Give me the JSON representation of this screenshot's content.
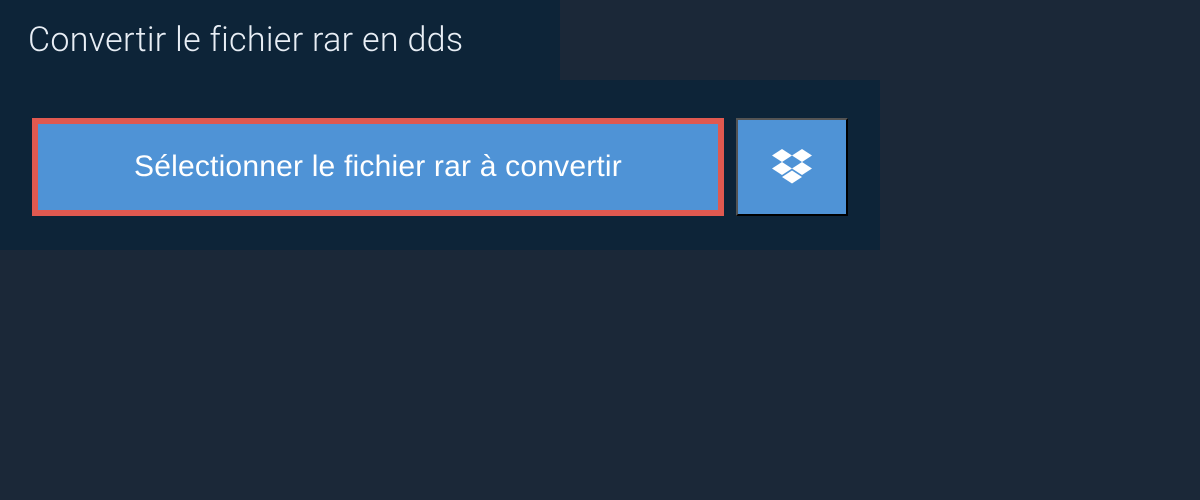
{
  "header": {
    "title": "Convertir le fichier rar en dds"
  },
  "actions": {
    "select_file_label": "Sélectionner le fichier rar à convertir"
  }
}
